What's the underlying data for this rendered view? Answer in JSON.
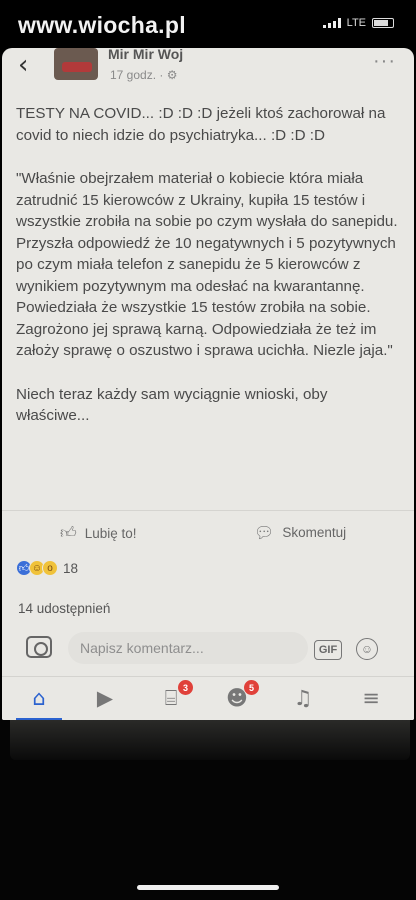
{
  "status_bar": {
    "watermark": "www.wiocha.pl",
    "network": "LTE"
  },
  "post": {
    "author": "Mir Mir Woj",
    "time": "17 godz. · ⚙",
    "paragraphs": [
      "TESTY NA COVID... :D :D :D  jeżeli ktoś zachorował na covid to niech idzie do psychiatryka...  :D  :D   :D",
      "\"Właśnie obejrzałem materiał o kobiecie która miała zatrudnić 15 kierowców z Ukrainy, kupiła 15 testów i wszystkie zrobiła na sobie po czym wysłała do sanepidu. Przyszła odpowiedź że 10 negatywnych i 5 pozytywnych po czym miała telefon z sanepidu że 5 kierowców z wynikiem pozytywnym ma odesłać na kwarantannę. Powiedziała że wszystkie 15 testów zrobiła na sobie. Zagrożono jej sprawą karną. Odpowiedziała że też im założy sprawę o oszustwo i sprawa ucichła. Niezle jaja.\"",
      "Niech teraz każdy sam wyciągnie wnioski, oby właściwe..."
    ]
  },
  "actions": {
    "like_label": "Lubię to!",
    "comment_label": "Skomentuj"
  },
  "reactions": {
    "count": "18"
  },
  "shares": "14 udostępnień",
  "comment_box": {
    "placeholder": "Napisz komentarz...",
    "gif_label": "GIF"
  },
  "tabbar": {
    "marketplace_badge": "3",
    "groups_badge": "5"
  }
}
